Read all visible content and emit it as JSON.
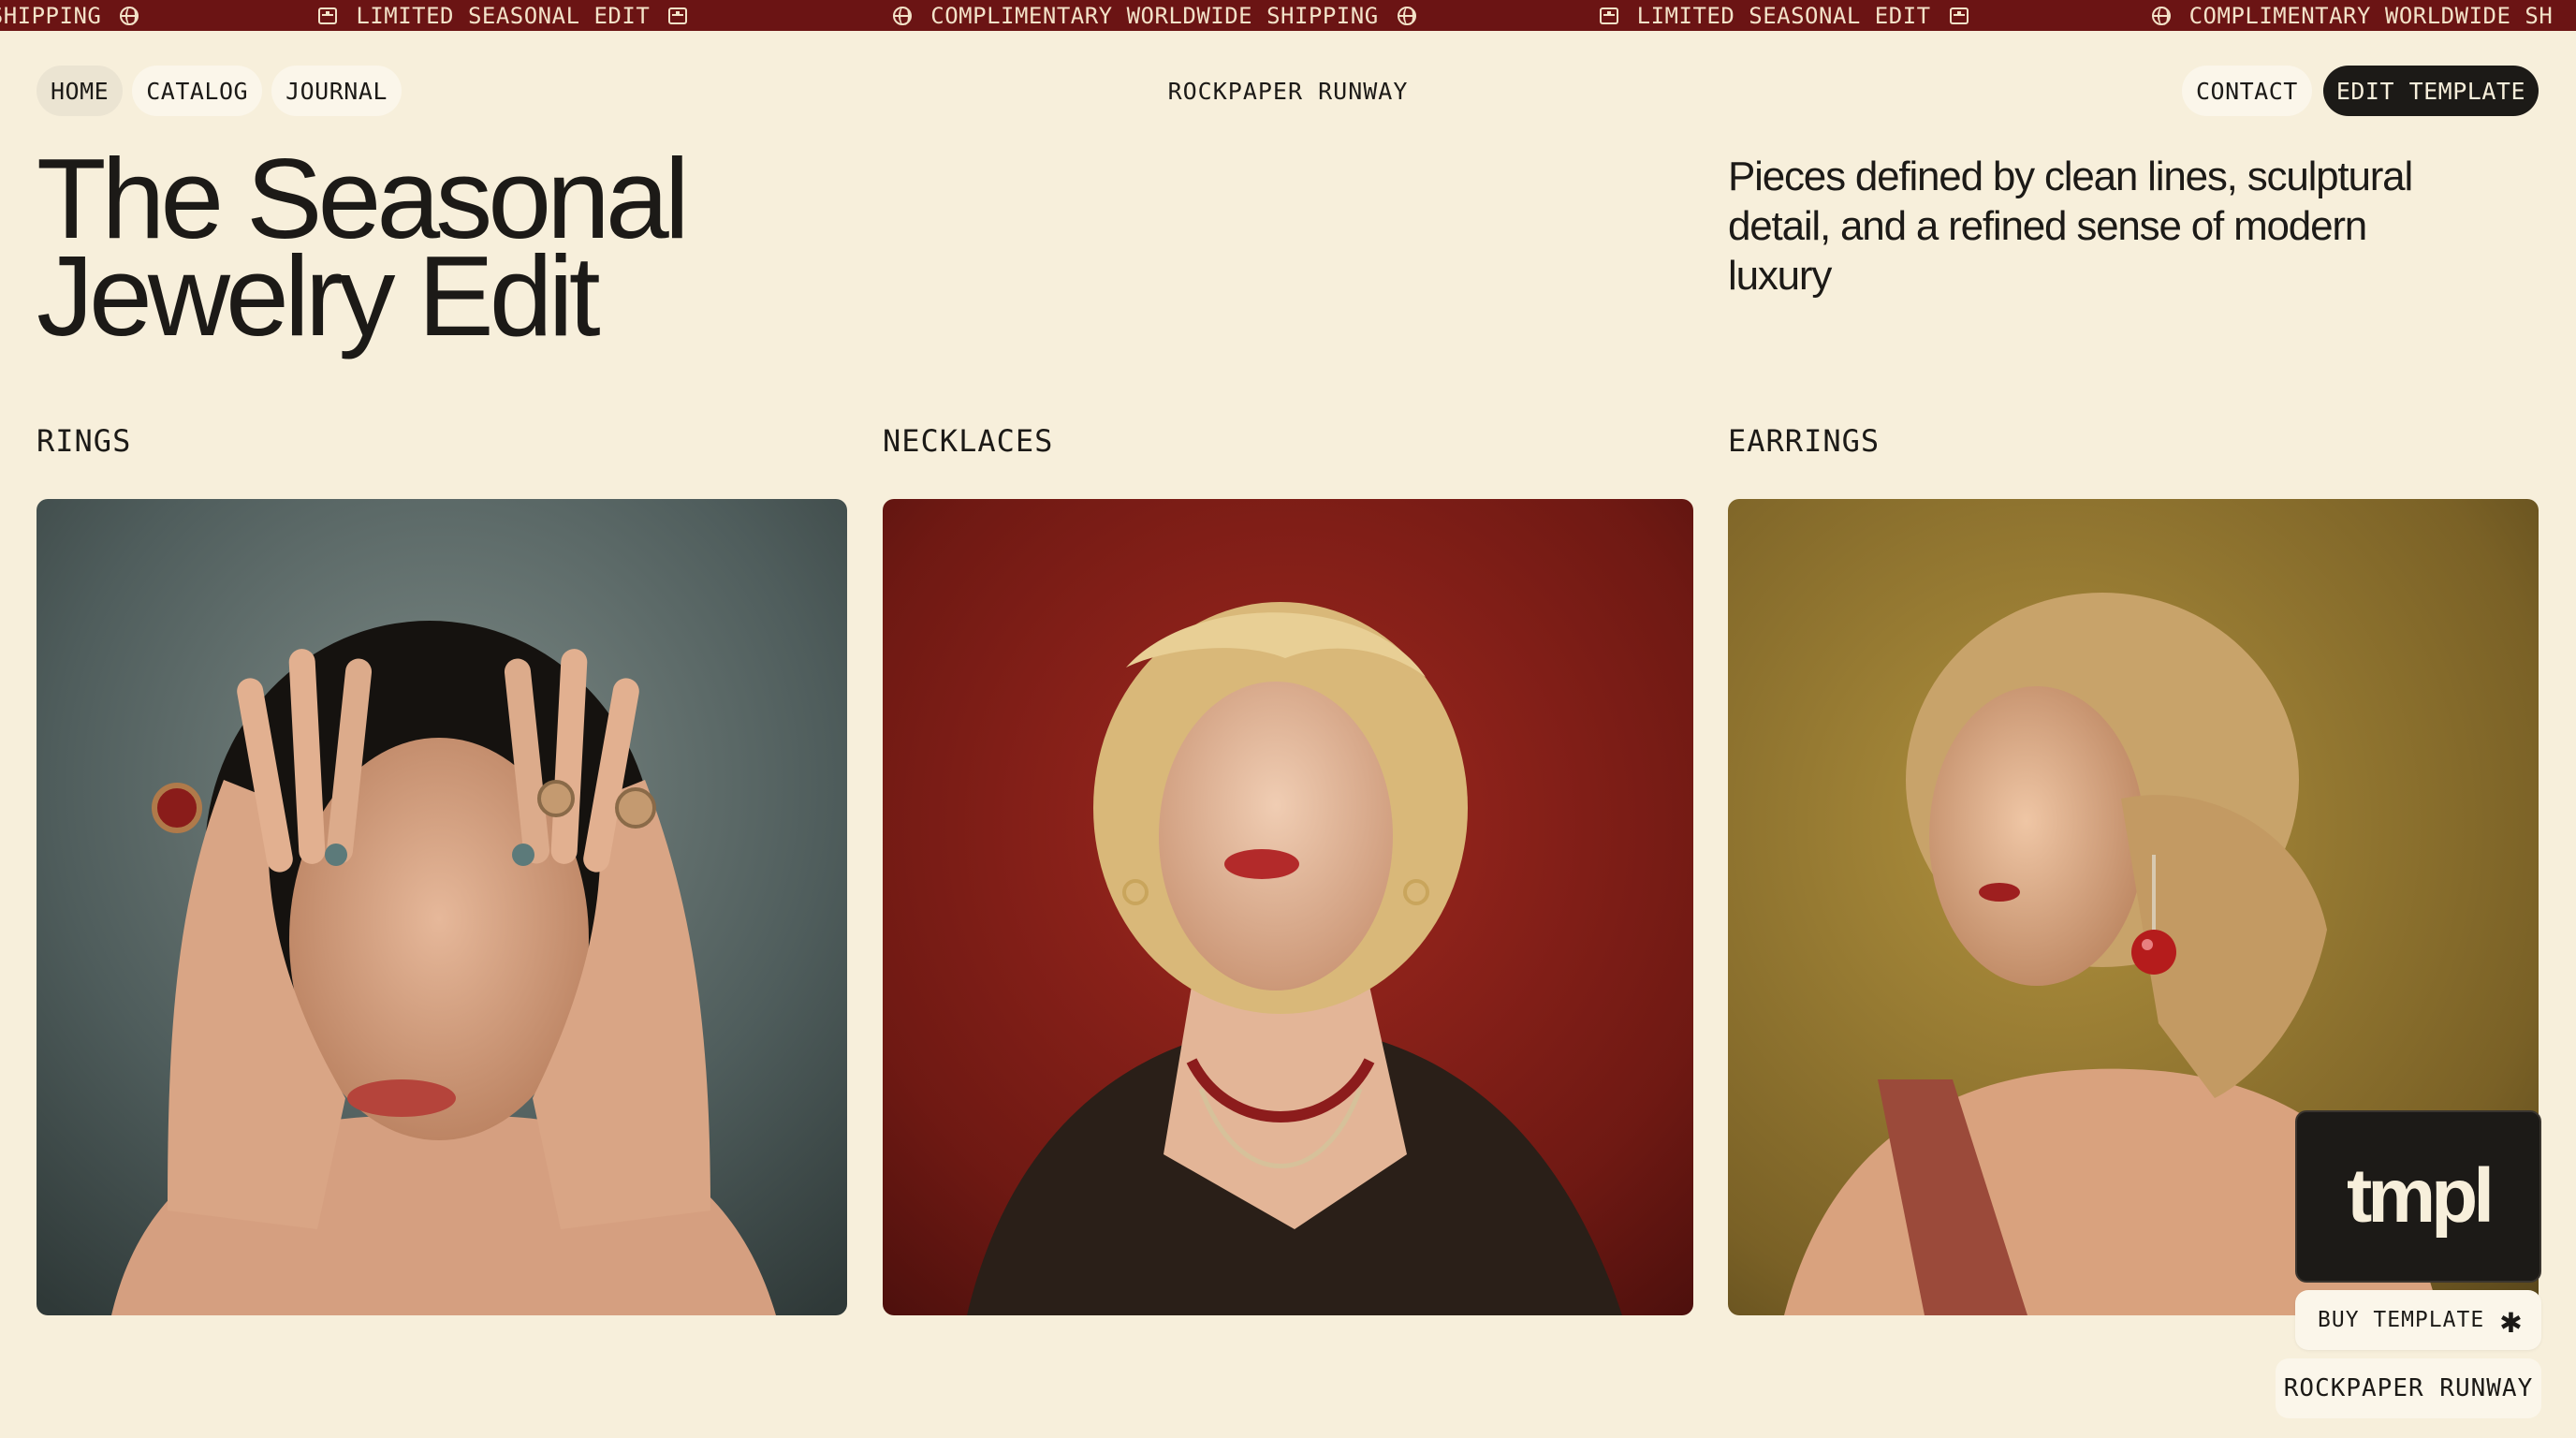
{
  "marquee": {
    "items": [
      {
        "text": "WIDE SHIPPING",
        "icon": "globe-icon"
      },
      {
        "text": "LIMITED SEASONAL EDIT",
        "icon": "box-icon"
      },
      {
        "text": "COMPLIMENTARY WORLDWIDE SHIPPING",
        "icon": "globe-icon"
      },
      {
        "text": "LIMITED SEASONAL EDIT",
        "icon": "box-icon"
      },
      {
        "text": "COMPLIMENTARY WORLDWIDE SH",
        "icon": ""
      }
    ],
    "colors": {
      "background": "#6b1414",
      "text": "#f3e2c8"
    }
  },
  "nav": {
    "left": [
      "HOME",
      "CATALOG",
      "JOURNAL"
    ],
    "brand": "ROCKPAPER RUNWAY",
    "right": {
      "contact": "CONTACT",
      "edit": "EDIT TEMPLATE"
    }
  },
  "hero": {
    "title_line1": "The Seasonal",
    "title_line2": "Jewelry Edit",
    "subtitle_line1": "Pieces defined by clean lines, sculptural",
    "subtitle_line2": "detail, and a refined sense of modern luxury"
  },
  "categories": [
    {
      "label": "RINGS"
    },
    {
      "label": "NECKLACES"
    },
    {
      "label": "EARRINGS"
    }
  ],
  "widget": {
    "logo": "tmpl",
    "buy": "BUY TEMPLATE",
    "brand": "ROCKPAPER RUNWAY"
  },
  "colors": {
    "page": "#f7efdb",
    "ink": "#1c1a17",
    "accent": "#6b1414"
  }
}
